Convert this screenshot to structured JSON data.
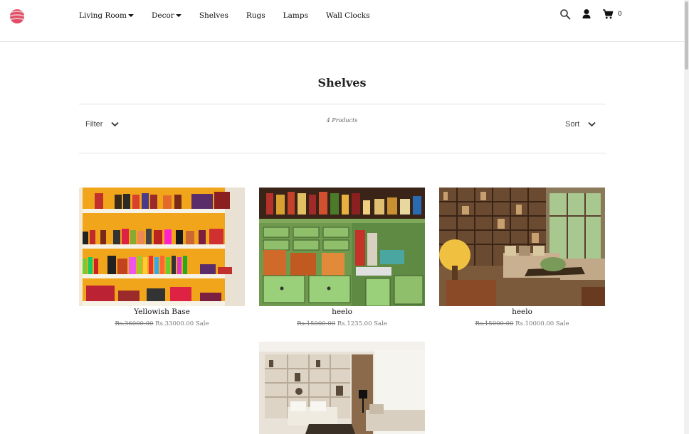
{
  "header": {
    "nav": [
      {
        "label": "Living Room",
        "dropdown": true
      },
      {
        "label": "Decor",
        "dropdown": true
      },
      {
        "label": "Shelves",
        "dropdown": false
      },
      {
        "label": "Rugs",
        "dropdown": false
      },
      {
        "label": "Lamps",
        "dropdown": false
      },
      {
        "label": "Wall Clocks",
        "dropdown": false
      }
    ],
    "icons": [
      "search-icon",
      "user-icon",
      "cart-icon"
    ],
    "cart_count": "0"
  },
  "collection": {
    "title": "Shelves",
    "filter_label": "Filter",
    "sort_label": "Sort",
    "product_count": "4 Products"
  },
  "products": [
    {
      "name": "Yellowish Base",
      "old_price": "Rs.36000.00",
      "price": "Rs.33000.00",
      "badge": "Sale"
    },
    {
      "name": "heelo",
      "old_price": "Rs.15000.00",
      "price": "Rs.1235.00",
      "badge": "Sale"
    },
    {
      "name": "heelo",
      "old_price": "Rs.15000.00",
      "price": "Rs.10000.00",
      "badge": "Sale"
    },
    {
      "name": "",
      "old_price": "",
      "price": "",
      "badge": ""
    }
  ],
  "colors": {
    "accent": "#e8465a",
    "text": "#222222",
    "rule": "#e3e3e3"
  }
}
